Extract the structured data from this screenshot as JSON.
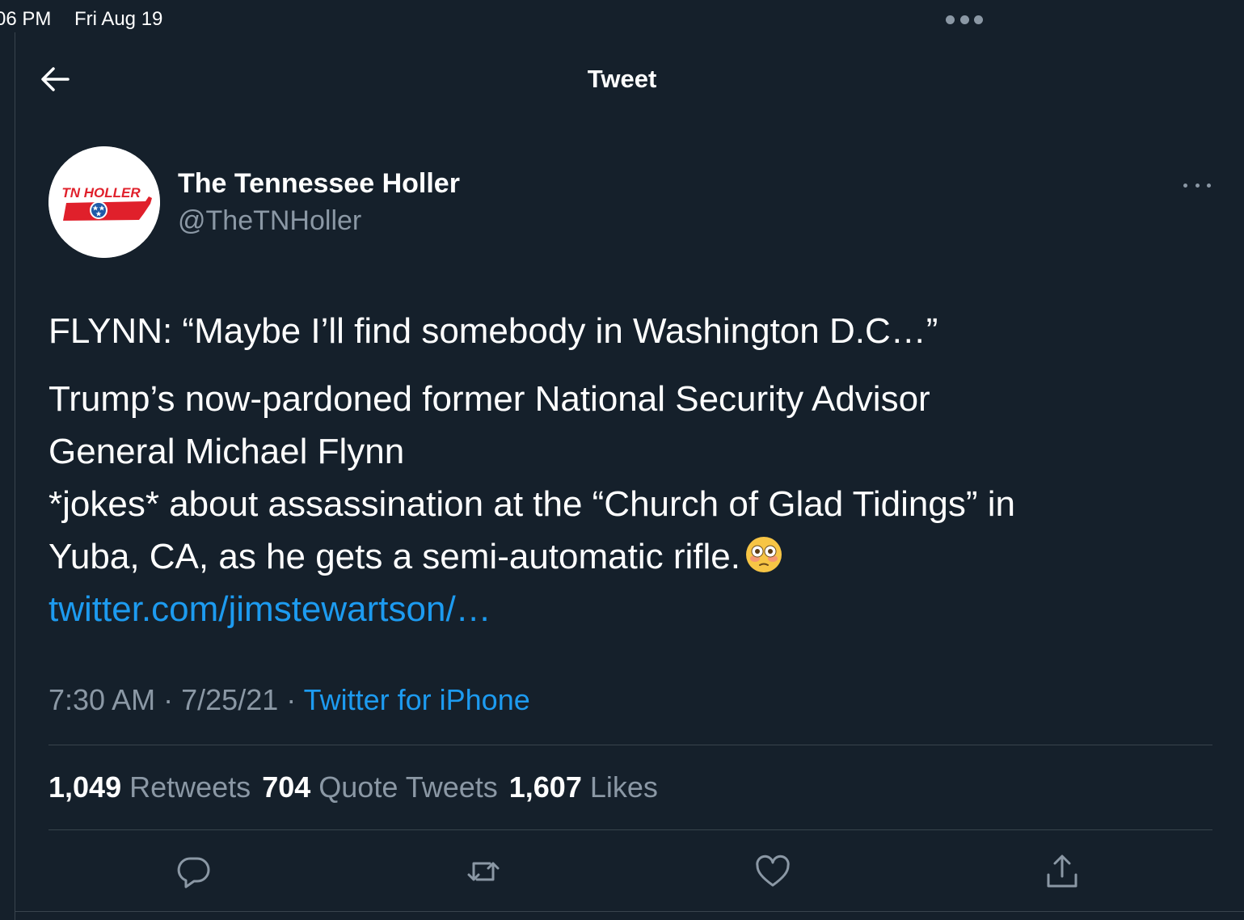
{
  "status_bar": {
    "time": "06 PM",
    "date": "Fri Aug 19"
  },
  "header": {
    "title": "Tweet",
    "back_icon": "arrow-left-icon"
  },
  "author": {
    "display_name": "The Tennessee Holler",
    "handle": "@TheTNHoller",
    "avatar_text": "TN HOLLER",
    "avatar_colors": {
      "text": "#e0202b",
      "state_shape": "#e0202b",
      "tristar": "#1f5aa8"
    }
  },
  "tweet": {
    "lines": [
      "FLYNN: “Maybe I’ll find somebody in Washington D.C…”",
      "Trump’s now-pardoned former National Security Advisor",
      "General Michael Flynn",
      "*jokes* about assassination at the “Church of Glad Tidings” in",
      "Yuba, CA, as he gets a semi-automatic rifle."
    ],
    "emoji": "flushed-face-emoji",
    "link": "twitter.com/jimstewartson/…",
    "time": "7:30 AM",
    "date": "7/25/21",
    "separator": "·",
    "source": "Twitter for iPhone"
  },
  "stats": {
    "retweets_count": "1,049",
    "retweets_label": "Retweets",
    "quotes_count": "704",
    "quotes_label": "Quote Tweets",
    "likes_count": "1,607",
    "likes_label": "Likes"
  },
  "actions": [
    "reply-icon",
    "retweet-icon",
    "like-icon",
    "share-icon"
  ],
  "colors": {
    "background": "#15202b",
    "text_primary": "#ffffff",
    "text_secondary": "#8b98a5",
    "accent": "#1d9bf0",
    "divider": "#38444d"
  }
}
